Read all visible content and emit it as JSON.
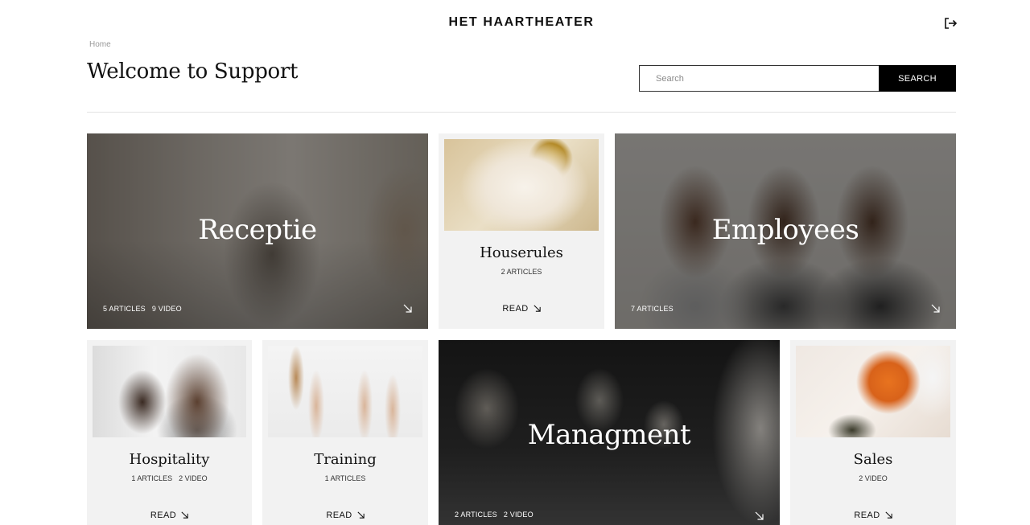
{
  "header": {
    "brand": "HET HAARTHEATER",
    "logout_icon": "logout-icon"
  },
  "breadcrumb": {
    "home": "Home"
  },
  "page": {
    "title": "Welcome to Support"
  },
  "search": {
    "placeholder": "Search",
    "button_label": "SEARCH"
  },
  "cards": {
    "receptie": {
      "title": "Receptie",
      "articles": "5 ARTICLES",
      "videos": "9 VIDEO"
    },
    "houserules": {
      "title": "Houserules",
      "articles": "2 ARTICLES",
      "read": "READ"
    },
    "employees": {
      "title": "Employees",
      "articles": "7 ARTICLES"
    },
    "hospitality": {
      "title": "Hospitality",
      "articles": "1 ARTICLES",
      "videos": "2 VIDEO",
      "read": "READ"
    },
    "training": {
      "title": "Training",
      "articles": "1 ARTICLES",
      "read": "READ"
    },
    "managment": {
      "title": "Managment",
      "articles": "2 ARTICLES",
      "videos": "2 VIDEO"
    },
    "sales": {
      "title": "Sales",
      "videos": "2 VIDEO",
      "read": "READ"
    }
  },
  "colors": {
    "accent": "#000000",
    "tile_bg": "#f2f2f2",
    "divider": "#e2e2e2"
  }
}
